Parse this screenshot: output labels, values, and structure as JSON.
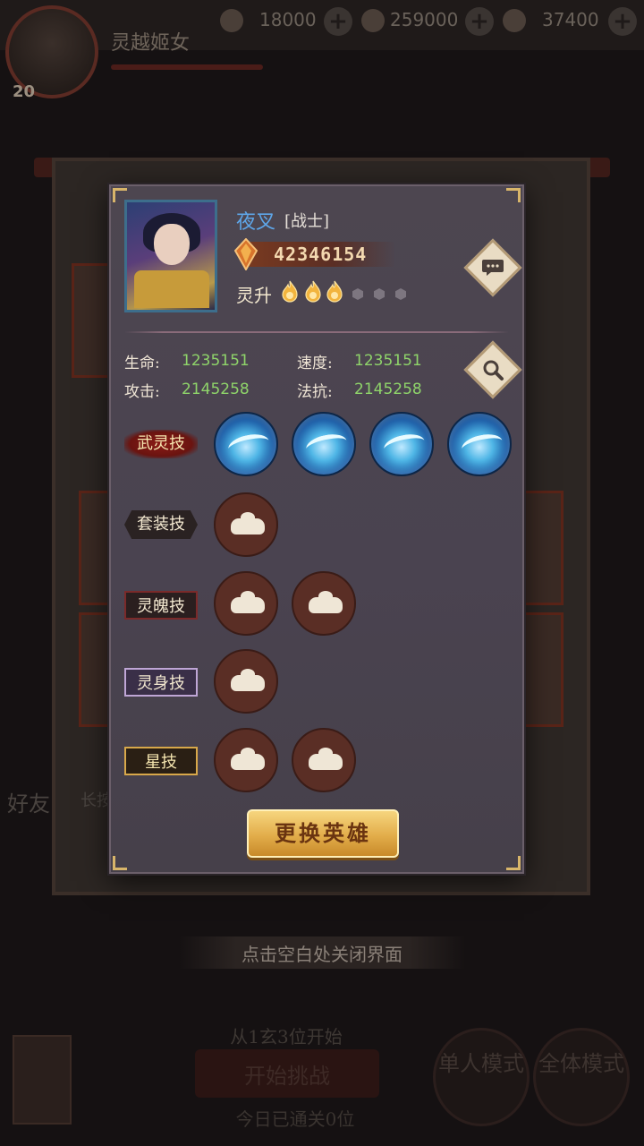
{
  "top_bar": {
    "player_name": "灵越姬女",
    "player_level": "20",
    "resources": [
      "18000",
      "259000",
      "37400"
    ]
  },
  "background": {
    "side_label": "好友",
    "hint_prefix": "长按",
    "close_hint": "点击空白处关闭界面",
    "start_info": "从1玄3位开始",
    "start_button": "开始挑战",
    "today_cleared": "今日已通关0位",
    "mode_single": "单人模式",
    "mode_all": "全体模式"
  },
  "hero": {
    "name": "夜叉",
    "class": "[战士]",
    "power": "42346154",
    "rank_label": "灵升",
    "rank_filled": 3,
    "rank_total": 6
  },
  "stats": {
    "hp_label": "生命:",
    "hp_value": "1235151",
    "speed_label": "速度:",
    "speed_value": "1235151",
    "atk_label": "攻击:",
    "atk_value": "2145258",
    "res_label": "法抗:",
    "res_value": "2145258"
  },
  "skills": {
    "wuling": "武灵技",
    "taozhuang": "套装技",
    "lingpo": "灵魄技",
    "lingshen": "灵身技",
    "xing": "星技"
  },
  "actions": {
    "change_hero": "更换英雄"
  },
  "icons": {
    "chat": "speech-bubble-icon",
    "inspect": "magnifier-icon"
  },
  "colors": {
    "accent_gold": "#e2ad4a",
    "hero_name": "#5ea6e8",
    "stat_value": "#8fd46a"
  }
}
